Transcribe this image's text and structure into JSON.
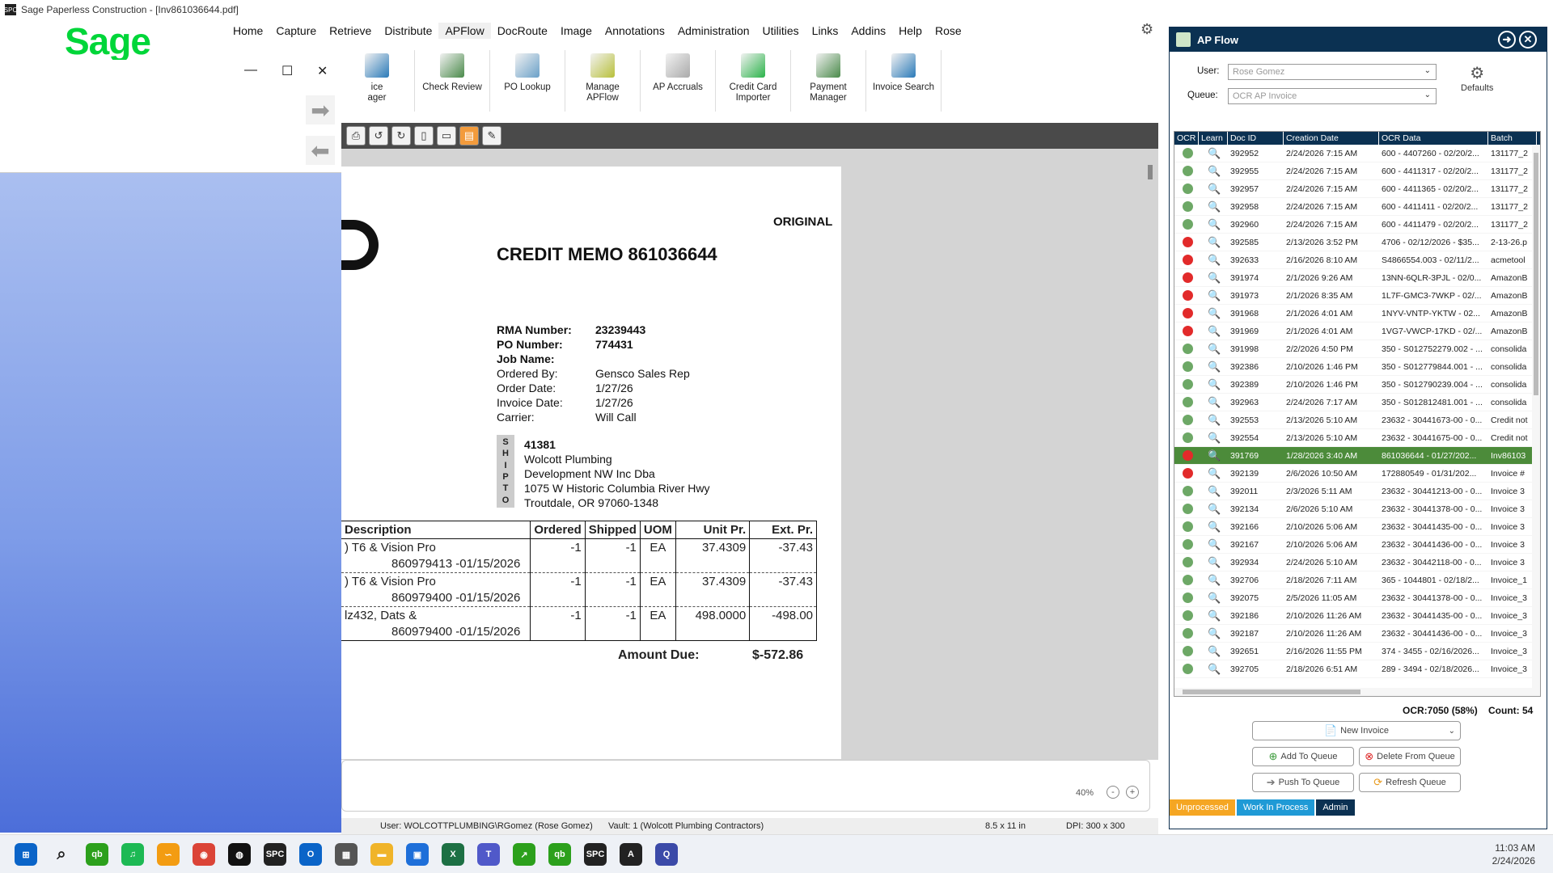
{
  "window": {
    "title": "Sage Paperless Construction - [Inv861036644.pdf]",
    "app_icon": "SPC"
  },
  "logo": {
    "text": "Sage"
  },
  "menu": [
    "Home",
    "Capture",
    "Retrieve",
    "Distribute",
    "APFlow",
    "DocRoute",
    "Image",
    "Annotations",
    "Administration",
    "Utilities",
    "Links",
    "Addins",
    "Help",
    "Rose"
  ],
  "ribbon": [
    {
      "label": "ice\nager",
      "icon": "invoice-manager-icon"
    },
    {
      "label": "Check Review",
      "icon": "check-review-icon"
    },
    {
      "label": "PO Lookup",
      "icon": "po-lookup-icon"
    },
    {
      "label": "Manage\nAPFlow",
      "icon": "manage-apflow-icon"
    },
    {
      "label": "AP Accruals",
      "icon": "ap-accruals-icon"
    },
    {
      "label": "Credit Card\nImporter",
      "icon": "credit-card-icon"
    },
    {
      "label": "Payment\nManager",
      "icon": "payment-manager-icon"
    },
    {
      "label": "Invoice Search",
      "icon": "invoice-search-icon"
    }
  ],
  "document": {
    "original": "ORIGINAL",
    "title": "CREDIT MEMO 861036644",
    "fields": [
      {
        "label": "RMA Number:",
        "value": "23239443",
        "bold": true
      },
      {
        "label": "PO Number:",
        "value": "774431",
        "bold": true
      },
      {
        "label": "Job Name:",
        "value": "",
        "bold": true
      },
      {
        "label": "Ordered By:",
        "value": "Gensco Sales Rep",
        "bold": false
      },
      {
        "label": "Order Date:",
        "value": "1/27/26",
        "bold": false
      },
      {
        "label": "Invoice Date:",
        "value": "1/27/26",
        "bold": false
      },
      {
        "label": "Carrier:",
        "value": "Will Call",
        "bold": false
      }
    ],
    "ship_to_label": [
      "S",
      "H",
      "I",
      "P",
      "T",
      "O"
    ],
    "ship_to": [
      "41381",
      "Wolcott Plumbing",
      "Development NW Inc Dba",
      "1075 W Historic Columbia River Hwy",
      "Troutdale, OR 97060-1348"
    ],
    "table_headers": [
      "Description",
      "Ordered",
      "Shipped",
      "UOM",
      "Unit Pr.",
      "Ext. Pr."
    ],
    "lines": [
      {
        "desc": ") T6 & Vision Pro",
        "ordered": "-1",
        "shipped": "-1",
        "uom": "EA",
        "unit": "37.4309",
        "ext": "-37.43",
        "ref": "860979413 -01/15/2026"
      },
      {
        "desc": ") T6 & Vision Pro",
        "ordered": "-1",
        "shipped": "-1",
        "uom": "EA",
        "unit": "37.4309",
        "ext": "-37.43",
        "ref": "860979400 -01/15/2026"
      },
      {
        "desc": "lz432, Dats &",
        "ordered": "-1",
        "shipped": "-1",
        "uom": "EA",
        "unit": "498.0000",
        "ext": "-498.00",
        "ref": "860979400 -01/15/2026"
      }
    ],
    "amount_due_label": "Amount Due:",
    "amount_due_value": "$-572.86"
  },
  "viewer": {
    "zoom": "40%",
    "zoom_out": "-",
    "zoom_in": "+"
  },
  "status": {
    "user": "User: WOLCOTTPLUMBING\\RGomez (Rose Gomez)",
    "vault": "Vault: 1 (Wolcott Plumbing Contractors)",
    "size": "8.5 x 11 in",
    "dpi": "DPI: 300 x 300"
  },
  "apflow": {
    "title": "AP Flow",
    "user_label": "User:",
    "user_value": "Rose Gomez",
    "queue_label": "Queue:",
    "queue_value": "OCR AP Invoice",
    "defaults_label": "Defaults",
    "columns": [
      "OCR",
      "Learn",
      "Doc ID",
      "Creation Date",
      "OCR Data",
      "Batch"
    ],
    "rows": [
      {
        "status": "green",
        "id": "392952",
        "date": "2/24/2026 7:15 AM",
        "ocr": "600 - 4407260 - 02/20/2...",
        "batch": "131177_2"
      },
      {
        "status": "green",
        "id": "392955",
        "date": "2/24/2026 7:15 AM",
        "ocr": "600 - 4411317 - 02/20/2...",
        "batch": "131177_2"
      },
      {
        "status": "green",
        "id": "392957",
        "date": "2/24/2026 7:15 AM",
        "ocr": "600 - 4411365 - 02/20/2...",
        "batch": "131177_2"
      },
      {
        "status": "green",
        "id": "392958",
        "date": "2/24/2026 7:15 AM",
        "ocr": "600 - 4411411 - 02/20/2...",
        "batch": "131177_2"
      },
      {
        "status": "green",
        "id": "392960",
        "date": "2/24/2026 7:15 AM",
        "ocr": "600 - 4411479 - 02/20/2...",
        "batch": "131177_2"
      },
      {
        "status": "red",
        "id": "392585",
        "date": "2/13/2026 3:52 PM",
        "ocr": "4706 - 02/12/2026 - $35...",
        "batch": "2-13-26.p"
      },
      {
        "status": "red",
        "id": "392633",
        "date": "2/16/2026 8:10 AM",
        "ocr": "S4866554.003 - 02/11/2...",
        "batch": "acmetool"
      },
      {
        "status": "red",
        "id": "391974",
        "date": "2/1/2026 9:26 AM",
        "ocr": "13NN-6QLR-3PJL - 02/0...",
        "batch": "AmazonB"
      },
      {
        "status": "red",
        "id": "391973",
        "date": "2/1/2026 8:35 AM",
        "ocr": "1L7F-GMC3-7WKP - 02/...",
        "batch": "AmazonB"
      },
      {
        "status": "red",
        "id": "391968",
        "date": "2/1/2026 4:01 AM",
        "ocr": "1NYV-VNTP-YKTW - 02...",
        "batch": "AmazonB"
      },
      {
        "status": "red",
        "id": "391969",
        "date": "2/1/2026 4:01 AM",
        "ocr": "1VG7-VWCP-17KD - 02/...",
        "batch": "AmazonB"
      },
      {
        "status": "green",
        "id": "391998",
        "date": "2/2/2026 4:50 PM",
        "ocr": "350 - S012752279.002 - ...",
        "batch": "consolida"
      },
      {
        "status": "green",
        "id": "392386",
        "date": "2/10/2026 1:46 PM",
        "ocr": "350 - S012779844.001 - ...",
        "batch": "consolida"
      },
      {
        "status": "green",
        "id": "392389",
        "date": "2/10/2026 1:46 PM",
        "ocr": "350 - S012790239.004 - ...",
        "batch": "consolida"
      },
      {
        "status": "green",
        "id": "392963",
        "date": "2/24/2026 7:17 AM",
        "ocr": "350 - S012812481.001 - ...",
        "batch": "consolida"
      },
      {
        "status": "green",
        "id": "392553",
        "date": "2/13/2026 5:10 AM",
        "ocr": "23632 - 30441673-00 - 0...",
        "batch": "Credit not"
      },
      {
        "status": "green",
        "id": "392554",
        "date": "2/13/2026 5:10 AM",
        "ocr": "23632 - 30441675-00 - 0...",
        "batch": "Credit not"
      },
      {
        "status": "red",
        "id": "391769",
        "date": "1/28/2026 3:40 AM",
        "ocr": "861036644 - 01/27/202...",
        "batch": "Inv86103",
        "selected": true
      },
      {
        "status": "red",
        "id": "392139",
        "date": "2/6/2026 10:50 AM",
        "ocr": "172880549 - 01/31/202...",
        "batch": "Invoice #"
      },
      {
        "status": "green",
        "id": "392011",
        "date": "2/3/2026 5:11 AM",
        "ocr": "23632 - 30441213-00 - 0...",
        "batch": "Invoice 3"
      },
      {
        "status": "green",
        "id": "392134",
        "date": "2/6/2026 5:10 AM",
        "ocr": "23632 - 30441378-00 - 0...",
        "batch": "Invoice 3"
      },
      {
        "status": "green",
        "id": "392166",
        "date": "2/10/2026 5:06 AM",
        "ocr": "23632 - 30441435-00 - 0...",
        "batch": "Invoice 3"
      },
      {
        "status": "green",
        "id": "392167",
        "date": "2/10/2026 5:06 AM",
        "ocr": "23632 - 30441436-00 - 0...",
        "batch": "Invoice 3"
      },
      {
        "status": "green",
        "id": "392934",
        "date": "2/24/2026 5:10 AM",
        "ocr": "23632 - 30442118-00 - 0...",
        "batch": "Invoice 3"
      },
      {
        "status": "green",
        "id": "392706",
        "date": "2/18/2026 7:11 AM",
        "ocr": "365 - 1044801 - 02/18/2...",
        "batch": "Invoice_1"
      },
      {
        "status": "green",
        "id": "392075",
        "date": "2/5/2026 11:05 AM",
        "ocr": "23632 - 30441378-00 - 0...",
        "batch": "Invoice_3"
      },
      {
        "status": "green",
        "id": "392186",
        "date": "2/10/2026 11:26 AM",
        "ocr": "23632 - 30441435-00 - 0...",
        "batch": "Invoice_3"
      },
      {
        "status": "green",
        "id": "392187",
        "date": "2/10/2026 11:26 AM",
        "ocr": "23632 - 30441436-00 - 0...",
        "batch": "Invoice_3"
      },
      {
        "status": "green",
        "id": "392651",
        "date": "2/16/2026 11:55 PM",
        "ocr": "374 - 3455 - 02/16/2026...",
        "batch": "Invoice_3"
      },
      {
        "status": "green",
        "id": "392705",
        "date": "2/18/2026 6:51 AM",
        "ocr": "289 - 3494 - 02/18/2026...",
        "batch": "Invoice_3"
      }
    ],
    "ocr_stat": "OCR:7050 (58%)",
    "count_stat": "Count: 54",
    "buttons": {
      "new_invoice": "New Invoice",
      "add_to_queue": "Add To Queue",
      "delete_from_queue": "Delete From Queue",
      "push_to_queue": "Push To Queue",
      "refresh_queue": "Refresh Queue"
    },
    "tabs": [
      {
        "label": "Unprocessed",
        "color": "#f5a623"
      },
      {
        "label": "Work In Process",
        "color": "#1f9ad6"
      },
      {
        "label": "Admin",
        "color": "#0b3152"
      }
    ]
  },
  "taskbar": {
    "time": "11:03 AM",
    "date": "2/24/2026",
    "apps": [
      {
        "name": "windows-start-icon",
        "glyph": "⊞",
        "color": "#0a64c8"
      },
      {
        "name": "search-icon",
        "glyph": "⌕",
        "color": "#333"
      },
      {
        "name": "quickbooks-icon",
        "glyph": "qb",
        "color": "#2ca01c"
      },
      {
        "name": "spotify-icon",
        "glyph": "♫",
        "color": "#1db954"
      },
      {
        "name": "app-swirl-icon",
        "glyph": "∽",
        "color": "#f39c12"
      },
      {
        "name": "chrome-icon",
        "glyph": "◉",
        "color": "#db4437"
      },
      {
        "name": "basketball-app-icon",
        "glyph": "◍",
        "color": "#111"
      },
      {
        "name": "spc-app-icon",
        "glyph": "SPC",
        "color": "#222"
      },
      {
        "name": "outlook-icon",
        "glyph": "O",
        "color": "#0a64c8"
      },
      {
        "name": "calculator-icon",
        "glyph": "▦",
        "color": "#555"
      },
      {
        "name": "file-explorer-icon",
        "glyph": "▬",
        "color": "#f0b429"
      },
      {
        "name": "remote-desktop-icon",
        "glyph": "▣",
        "color": "#1e6fd9"
      },
      {
        "name": "excel-icon",
        "glyph": "X",
        "color": "#1d7044"
      },
      {
        "name": "teams-icon",
        "glyph": "T",
        "color": "#5059c9"
      },
      {
        "name": "sage-app-icon",
        "glyph": "↗",
        "color": "#2ca01c"
      },
      {
        "name": "quickbooks2-icon",
        "glyph": "qb",
        "color": "#2ca01c"
      },
      {
        "name": "spc-app2-icon",
        "glyph": "SPC",
        "color": "#222"
      },
      {
        "name": "acrobat-icon",
        "glyph": "A",
        "color": "#222"
      },
      {
        "name": "app-q-icon",
        "glyph": "Q",
        "color": "#3b4aa8"
      }
    ]
  }
}
